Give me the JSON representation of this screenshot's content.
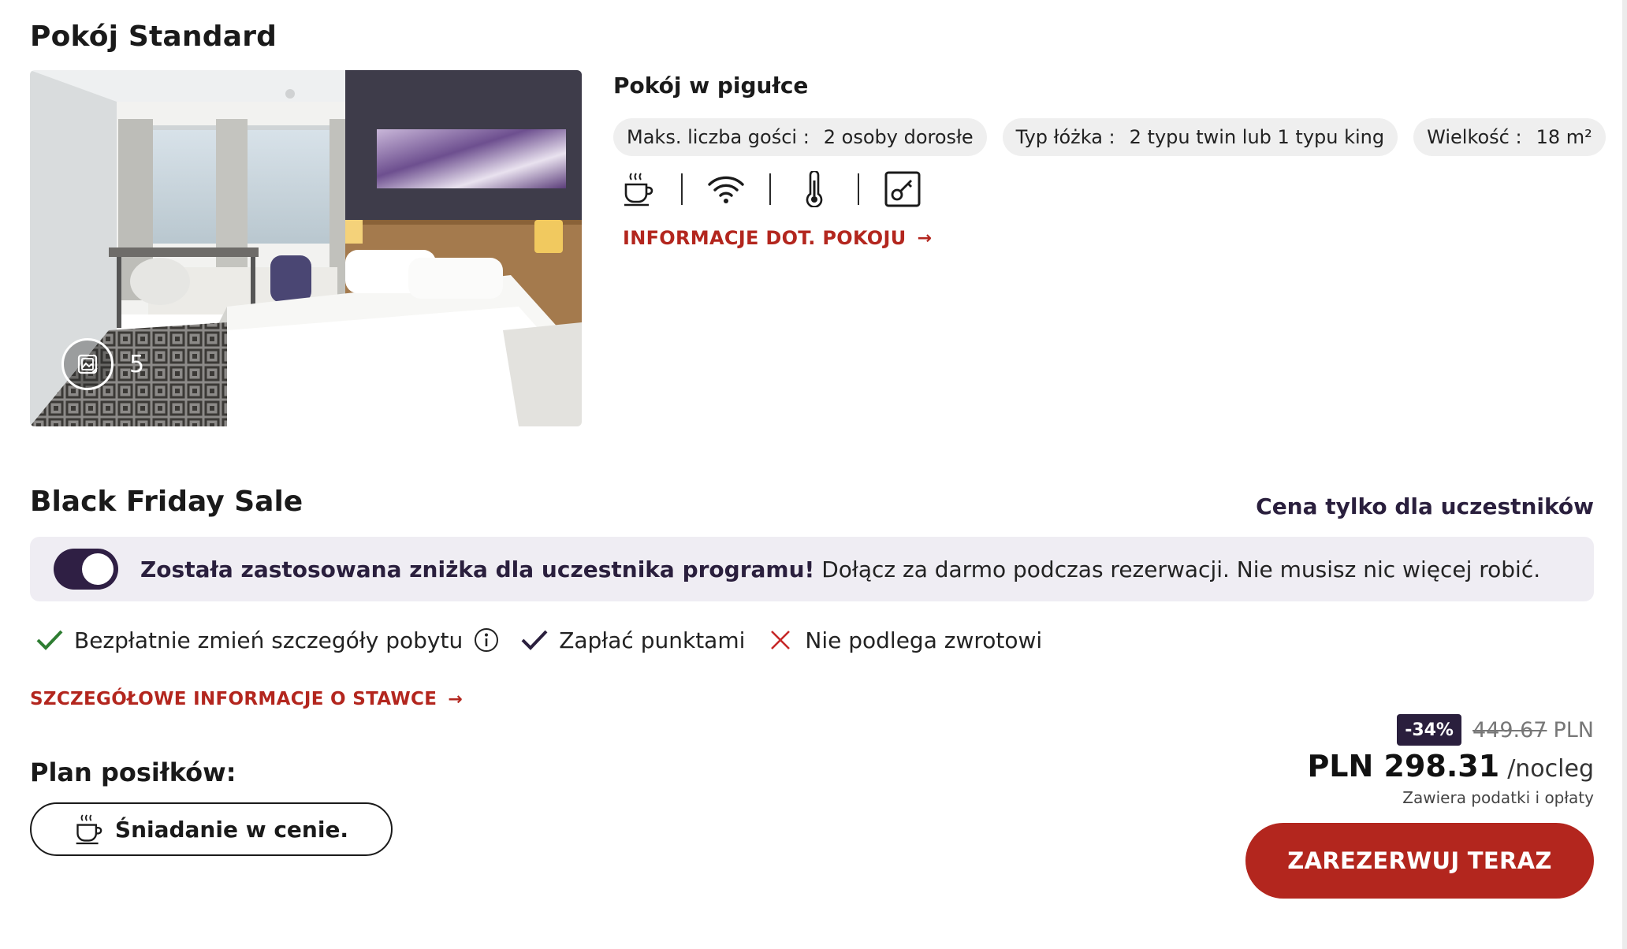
{
  "room": {
    "title": "Pokój Standard",
    "gallery_count": "5"
  },
  "summary": {
    "title": "Pokój w pigułce",
    "chips": [
      {
        "label": "Maks. liczba gości :",
        "value": "2 osoby dorosłe"
      },
      {
        "label": "Typ łóżka :",
        "value": "2 typu twin lub 1 typu king"
      },
      {
        "label": "Wielkość :",
        "value": "18 m²"
      }
    ],
    "amenity_icons": [
      "coffee-cup-icon",
      "wifi-icon",
      "thermometer-icon",
      "key-card-icon"
    ],
    "room_info_link": "INFORMACJE DOT. POKOJU"
  },
  "rate": {
    "title": "Black Friday Sale",
    "members_only": "Cena tylko dla uczestników",
    "banner_strong": "Została zastosowana zniżka dla uczestnika programu!",
    "banner_text": " Dołącz za darmo podczas rezerwacji. Nie musisz nic więcej robić.",
    "toggle_on": true,
    "benefits": [
      {
        "text": "Bezpłatnie zmień szczegóły pobytu",
        "icon": "check-icon",
        "color": "#2e7d32"
      },
      {
        "text": "Zapłać punktami",
        "icon": "check-icon",
        "color": "#2a1f3d"
      },
      {
        "text": "Nie podlega zwrotowi",
        "icon": "cross-icon",
        "color": "#c62828"
      }
    ],
    "rate_info_link": "SZCZEGÓŁOWE INFORMACJE O STAWCE",
    "meal_plan_title": "Plan posiłków:",
    "meal_plan_value": "Śniadanie w cenie."
  },
  "price": {
    "discount": "-34%",
    "old_price": "449.67",
    "old_currency": "PLN",
    "current": "PLN 298.31",
    "unit": "/nocleg",
    "tax_note": "Zawiera podatki i opłaty",
    "book_label": "ZAREZERWUJ TERAZ"
  },
  "colors": {
    "accent_red": "#b3261e",
    "brand_purple": "#2a1f3d",
    "banner_bg": "#efedf3"
  }
}
